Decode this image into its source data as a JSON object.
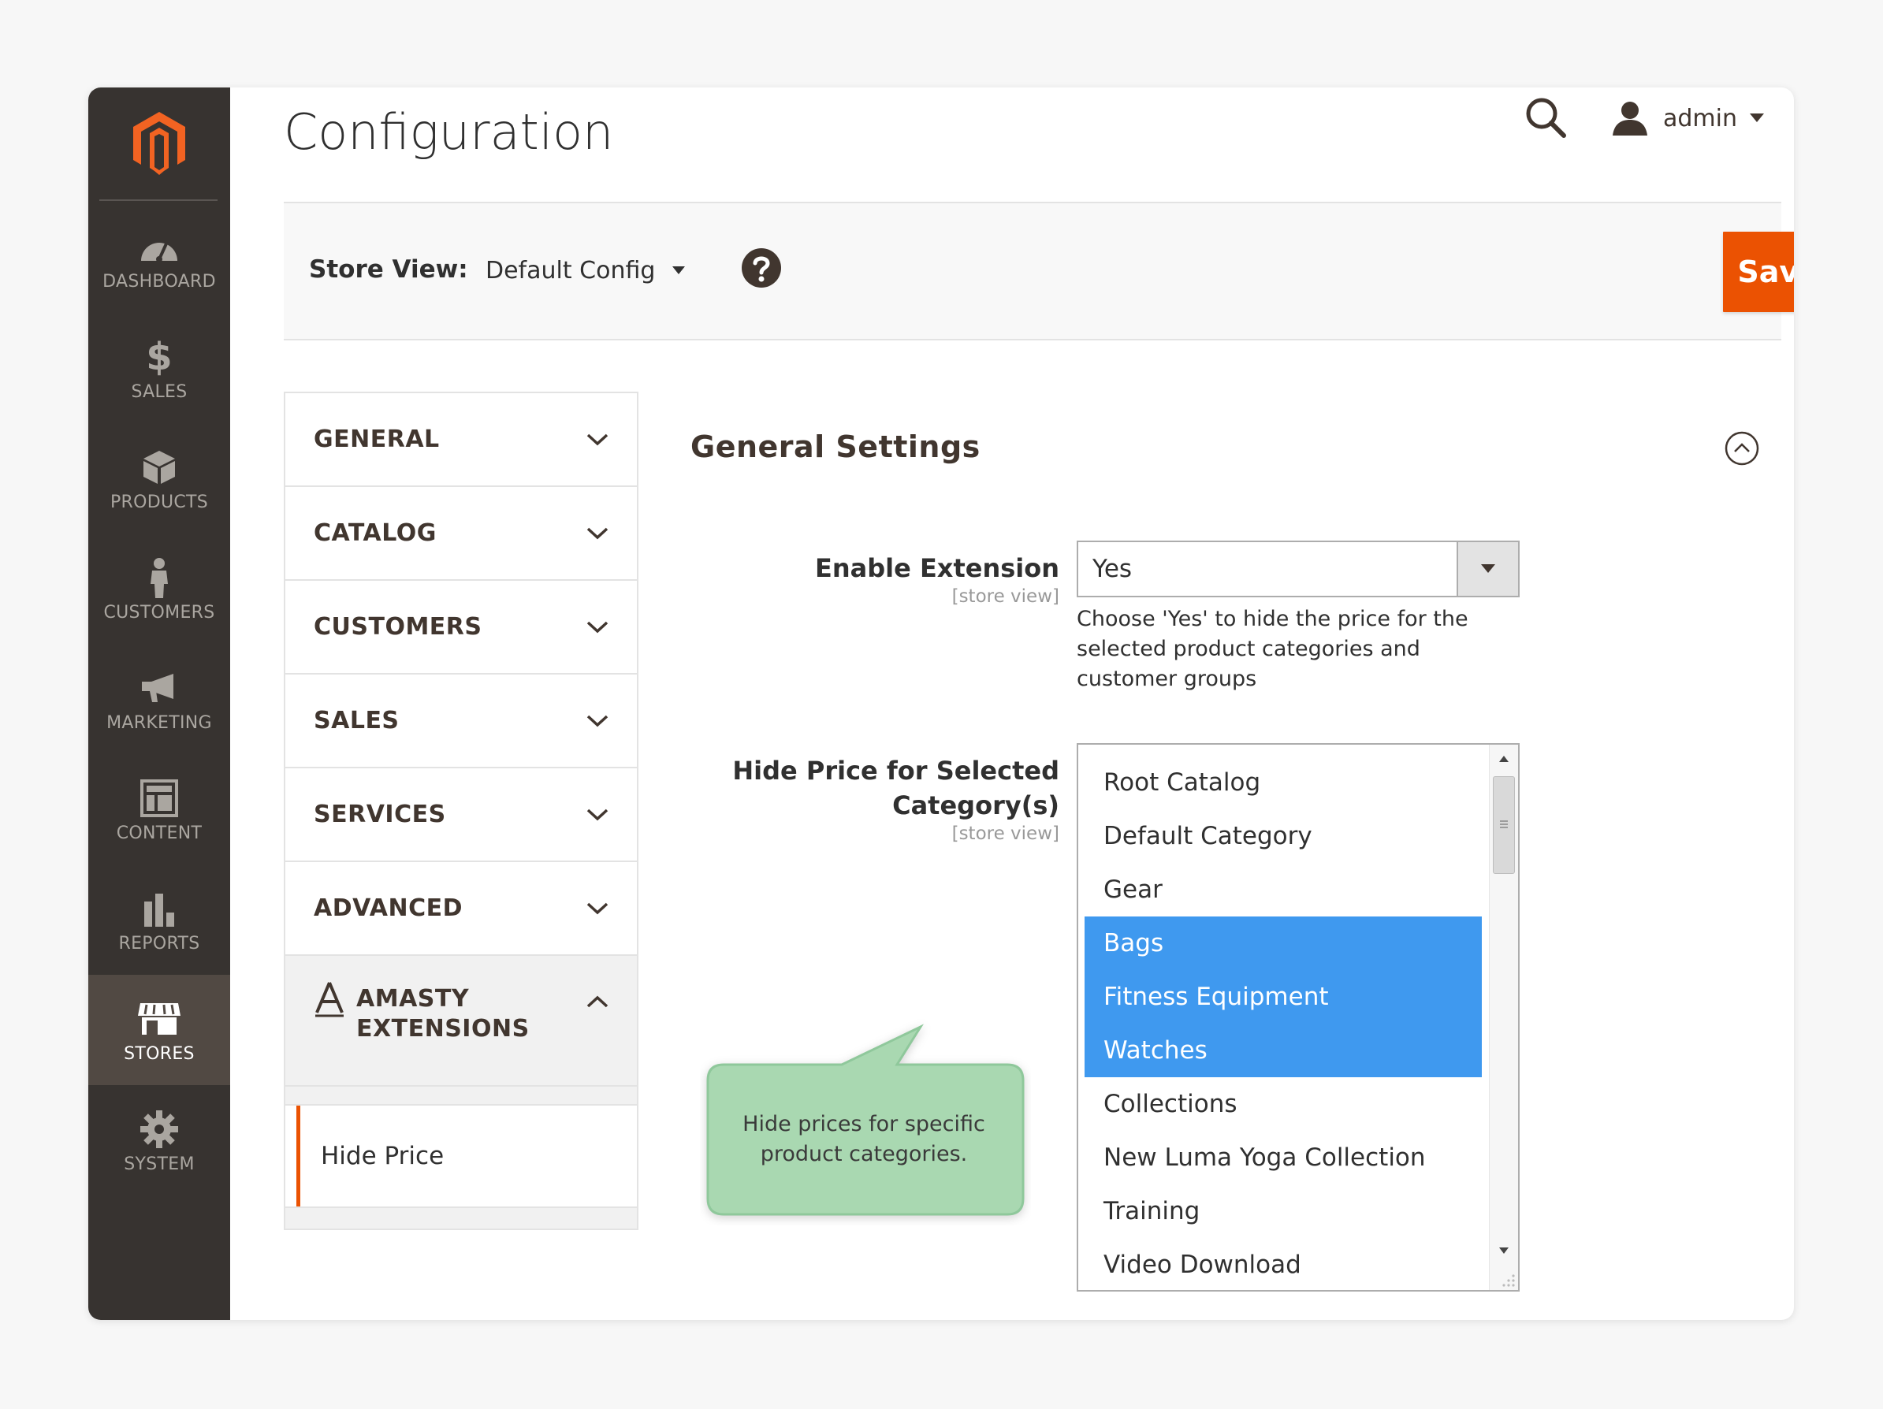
{
  "nav": {
    "items": [
      {
        "label": "DASHBOARD",
        "icon": "dashboard-icon"
      },
      {
        "label": "SALES",
        "icon": "dollar-icon"
      },
      {
        "label": "PRODUCTS",
        "icon": "box-icon"
      },
      {
        "label": "CUSTOMERS",
        "icon": "person-icon"
      },
      {
        "label": "MARKETING",
        "icon": "megaphone-icon"
      },
      {
        "label": "CONTENT",
        "icon": "layout-icon"
      },
      {
        "label": "REPORTS",
        "icon": "bar-chart-icon"
      },
      {
        "label": "STORES",
        "icon": "storefront-icon"
      },
      {
        "label": "SYSTEM",
        "icon": "gear-icon"
      }
    ],
    "active": "STORES"
  },
  "header": {
    "title": "Configuration",
    "account_name": "admin"
  },
  "store_bar": {
    "label": "Store View:",
    "selected": "Default Config",
    "save_label": "Save Config"
  },
  "tabs": [
    {
      "label": "GENERAL"
    },
    {
      "label": "CATALOG"
    },
    {
      "label": "CUSTOMERS"
    },
    {
      "label": "SALES"
    },
    {
      "label": "SERVICES"
    },
    {
      "label": "ADVANCED"
    }
  ],
  "open_tab": {
    "label_line1": "AMASTY",
    "label_line2": "EXTENSIONS",
    "subtab": "Hide Price"
  },
  "section": {
    "title": "General Settings",
    "enable": {
      "label": "Enable Extension",
      "scope": "[store view]",
      "value": "Yes",
      "note": "Choose 'Yes' to hide the price for the selected product categories and customer groups"
    },
    "categories": {
      "label_line1": "Hide Price for Selected",
      "label_line2": "Category(s)",
      "scope": "[store view]",
      "options": [
        {
          "label": "Root Catalog",
          "selected": false
        },
        {
          "label": "Default Category",
          "selected": false
        },
        {
          "label": "Gear",
          "selected": false
        },
        {
          "label": "Bags",
          "selected": true
        },
        {
          "label": "Fitness Equipment",
          "selected": true
        },
        {
          "label": "Watches",
          "selected": true
        },
        {
          "label": "Collections",
          "selected": false
        },
        {
          "label": "New Luma Yoga Collection",
          "selected": false
        },
        {
          "label": "Training",
          "selected": false
        },
        {
          "label": "Video Download",
          "selected": false
        }
      ]
    }
  },
  "callout": {
    "text": "Hide prices for specific product categories."
  },
  "colors": {
    "nav_bg": "#373330",
    "nav_active": "#514943",
    "accent": "#eb5202",
    "selected_option": "#3f99ef",
    "callout_fill": "#a9d8b1",
    "callout_border": "#8fc89b"
  }
}
